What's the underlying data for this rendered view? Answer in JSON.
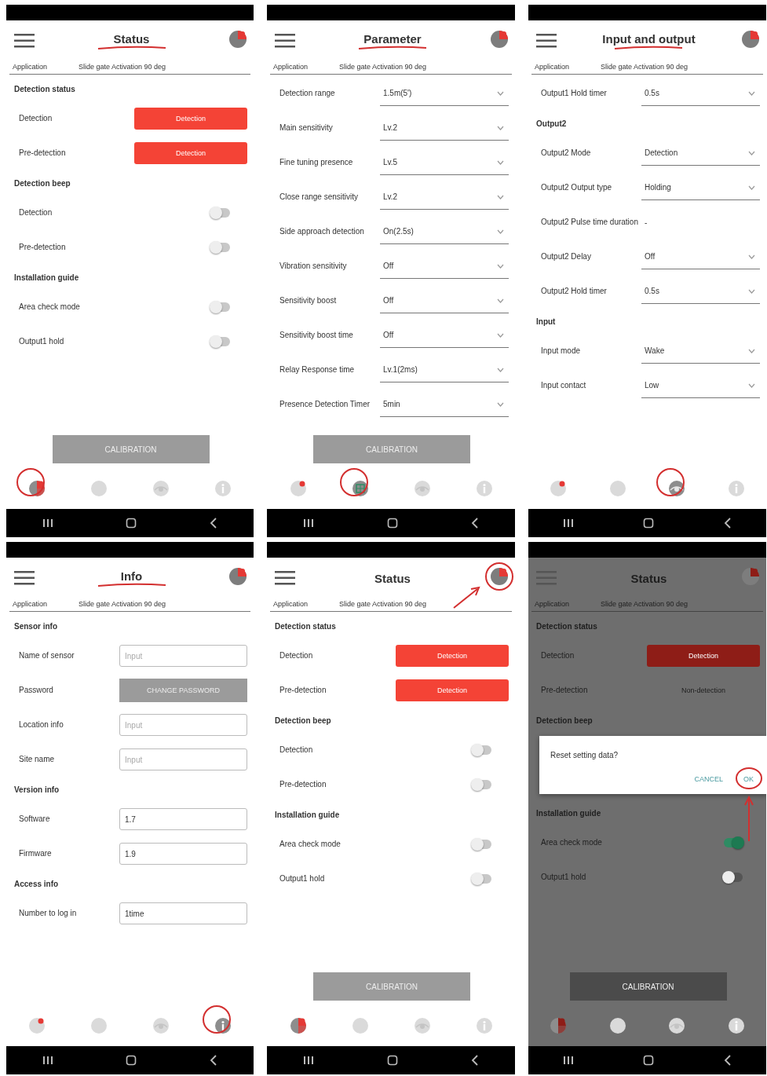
{
  "panels": [
    {
      "title": "Status",
      "title_underlined": true,
      "application_label": "Application",
      "application_value": "Slide gate Activation 90 deg",
      "rows": [
        {
          "kind": "section",
          "text": "Detection status"
        },
        {
          "kind": "status",
          "label": "Detection",
          "value": "Detection",
          "active": true
        },
        {
          "kind": "status",
          "label": "Pre-detection",
          "value": "Detection",
          "active": true
        },
        {
          "kind": "section",
          "text": "Detection beep"
        },
        {
          "kind": "toggle",
          "label": "Detection",
          "on": false
        },
        {
          "kind": "toggle",
          "label": "Pre-detection",
          "on": false
        },
        {
          "kind": "section",
          "text": "Installation guide"
        },
        {
          "kind": "toggle",
          "label": "Area check mode",
          "on": false
        },
        {
          "kind": "toggle",
          "label": "Output1 hold",
          "on": false
        }
      ],
      "bottom_button": "CALIBRATION",
      "nav": [
        {
          "kind": "status",
          "selected": true,
          "circled": true
        },
        {
          "kind": "parameter",
          "selected": false
        },
        {
          "kind": "io",
          "selected": false
        },
        {
          "kind": "info",
          "selected": false
        }
      ]
    },
    {
      "title": "Parameter",
      "title_underlined": true,
      "application_label": "Application",
      "application_value": "Slide gate Activation 90 deg",
      "rows": [
        {
          "kind": "select",
          "label": "Detection range",
          "value": "1.5m(5')"
        },
        {
          "kind": "select",
          "label": "Main sensitivity",
          "value": "Lv.2"
        },
        {
          "kind": "select",
          "label": "Fine tuning presence",
          "value": "Lv.5"
        },
        {
          "kind": "select",
          "label": "Close range sensitivity",
          "value": "Lv.2"
        },
        {
          "kind": "select",
          "label": "Side approach detection",
          "value": "On(2.5s)"
        },
        {
          "kind": "select",
          "label": "Vibration sensitivity",
          "value": "Off"
        },
        {
          "kind": "select",
          "label": "Sensitivity boost",
          "value": "Off"
        },
        {
          "kind": "select",
          "label": "Sensitivity boost time",
          "value": "Off"
        },
        {
          "kind": "select",
          "label": "Relay Response time",
          "value": "Lv.1(2ms)"
        },
        {
          "kind": "select",
          "label": "Presence Detection Timer",
          "value": "5min"
        }
      ],
      "bottom_button": "CALIBRATION",
      "nav": [
        {
          "kind": "status",
          "selected": false
        },
        {
          "kind": "parameter",
          "selected": true,
          "circled": true
        },
        {
          "kind": "io",
          "selected": false
        },
        {
          "kind": "info",
          "selected": false
        }
      ]
    },
    {
      "title": "Input and output",
      "title_underlined": true,
      "application_label": "Application",
      "application_value": "Slide gate Activation 90 deg",
      "rows": [
        {
          "kind": "select",
          "label": "Output1 Hold timer",
          "value": "0.5s"
        },
        {
          "kind": "section",
          "text": "Output2"
        },
        {
          "kind": "select",
          "label": "Output2 Mode",
          "value": "Detection"
        },
        {
          "kind": "select",
          "label": "Output2 Output type",
          "value": "Holding"
        },
        {
          "kind": "readonly",
          "label": "Output2 Pulse time duration",
          "value": "-"
        },
        {
          "kind": "select",
          "label": "Output2 Delay",
          "value": "Off"
        },
        {
          "kind": "select",
          "label": "Output2 Hold timer",
          "value": "0.5s"
        },
        {
          "kind": "section",
          "text": "Input"
        },
        {
          "kind": "select",
          "label": "Input mode",
          "value": "Wake"
        },
        {
          "kind": "select",
          "label": "Input contact",
          "value": "Low"
        }
      ],
      "nav": [
        {
          "kind": "status",
          "selected": false
        },
        {
          "kind": "parameter",
          "selected": false
        },
        {
          "kind": "io",
          "selected": true,
          "circled": true
        },
        {
          "kind": "info",
          "selected": false
        }
      ]
    },
    {
      "title": "Info",
      "title_underlined": true,
      "application_label": "Application",
      "application_value": "Slide gate Activation 90 deg",
      "rows": [
        {
          "kind": "section",
          "text": "Sensor info"
        },
        {
          "kind": "input",
          "label": "Name of sensor",
          "placeholder": "Input"
        },
        {
          "kind": "action",
          "label": "Password",
          "button": "CHANGE PASSWORD"
        },
        {
          "kind": "input",
          "label": "Location info",
          "placeholder": "Input"
        },
        {
          "kind": "input",
          "label": "Site name",
          "placeholder": "Input"
        },
        {
          "kind": "section",
          "text": "Version info"
        },
        {
          "kind": "input",
          "label": "Software",
          "value": "1.7"
        },
        {
          "kind": "input",
          "label": "Firmware",
          "value": "1.9"
        },
        {
          "kind": "section",
          "text": "Access info"
        },
        {
          "kind": "input",
          "label": "Number to log in",
          "value": "1time"
        }
      ],
      "nav": [
        {
          "kind": "status",
          "selected": false
        },
        {
          "kind": "parameter",
          "selected": false
        },
        {
          "kind": "io",
          "selected": false
        },
        {
          "kind": "info",
          "selected": true,
          "circled": true
        }
      ]
    },
    {
      "title": "Status",
      "avatar_circled": true,
      "avatar_arrow": true,
      "application_label": "Application",
      "application_value": "Slide gate Activation 90 deg",
      "rows": [
        {
          "kind": "section",
          "text": "Detection status"
        },
        {
          "kind": "status",
          "label": "Detection",
          "value": "Detection",
          "active": true
        },
        {
          "kind": "status",
          "label": "Pre-detection",
          "value": "Detection",
          "active": true
        },
        {
          "kind": "section",
          "text": "Detection beep"
        },
        {
          "kind": "toggle",
          "label": "Detection",
          "on": false
        },
        {
          "kind": "toggle",
          "label": "Pre-detection",
          "on": false
        },
        {
          "kind": "section",
          "text": "Installation guide"
        },
        {
          "kind": "toggle",
          "label": "Area check mode",
          "on": false
        },
        {
          "kind": "toggle",
          "label": "Output1 hold",
          "on": false
        }
      ],
      "bottom_button": "CALIBRATION",
      "nav": [
        {
          "kind": "status",
          "selected": true
        },
        {
          "kind": "parameter",
          "selected": false
        },
        {
          "kind": "io",
          "selected": false
        },
        {
          "kind": "info",
          "selected": false
        }
      ]
    },
    {
      "title": "Status",
      "dimmed": true,
      "application_label": "Application",
      "application_value": "Slide gate Activation 90 deg",
      "rows": [
        {
          "kind": "section",
          "text": "Detection status"
        },
        {
          "kind": "status",
          "label": "Detection",
          "value": "Detection",
          "active": true
        },
        {
          "kind": "status",
          "label": "Pre-detection",
          "value": "Non-detection",
          "active": false
        },
        {
          "kind": "section",
          "text": "Detection beep"
        },
        {
          "kind": "dialog",
          "message": "Reset setting data?",
          "buttons": [
            {
              "label": "CANCEL"
            },
            {
              "label": "OK",
              "circled": true,
              "arrow": true
            }
          ]
        },
        {
          "kind": "section",
          "text": "Installation guide"
        },
        {
          "kind": "toggle",
          "label": "Area check mode",
          "on": true
        },
        {
          "kind": "toggle",
          "label": "Output1 hold",
          "on": false
        }
      ],
      "bottom_button": "CALIBRATION",
      "nav": [
        {
          "kind": "status",
          "selected": true
        },
        {
          "kind": "parameter",
          "selected": false
        },
        {
          "kind": "io",
          "selected": false
        },
        {
          "kind": "info",
          "selected": false
        }
      ]
    }
  ]
}
